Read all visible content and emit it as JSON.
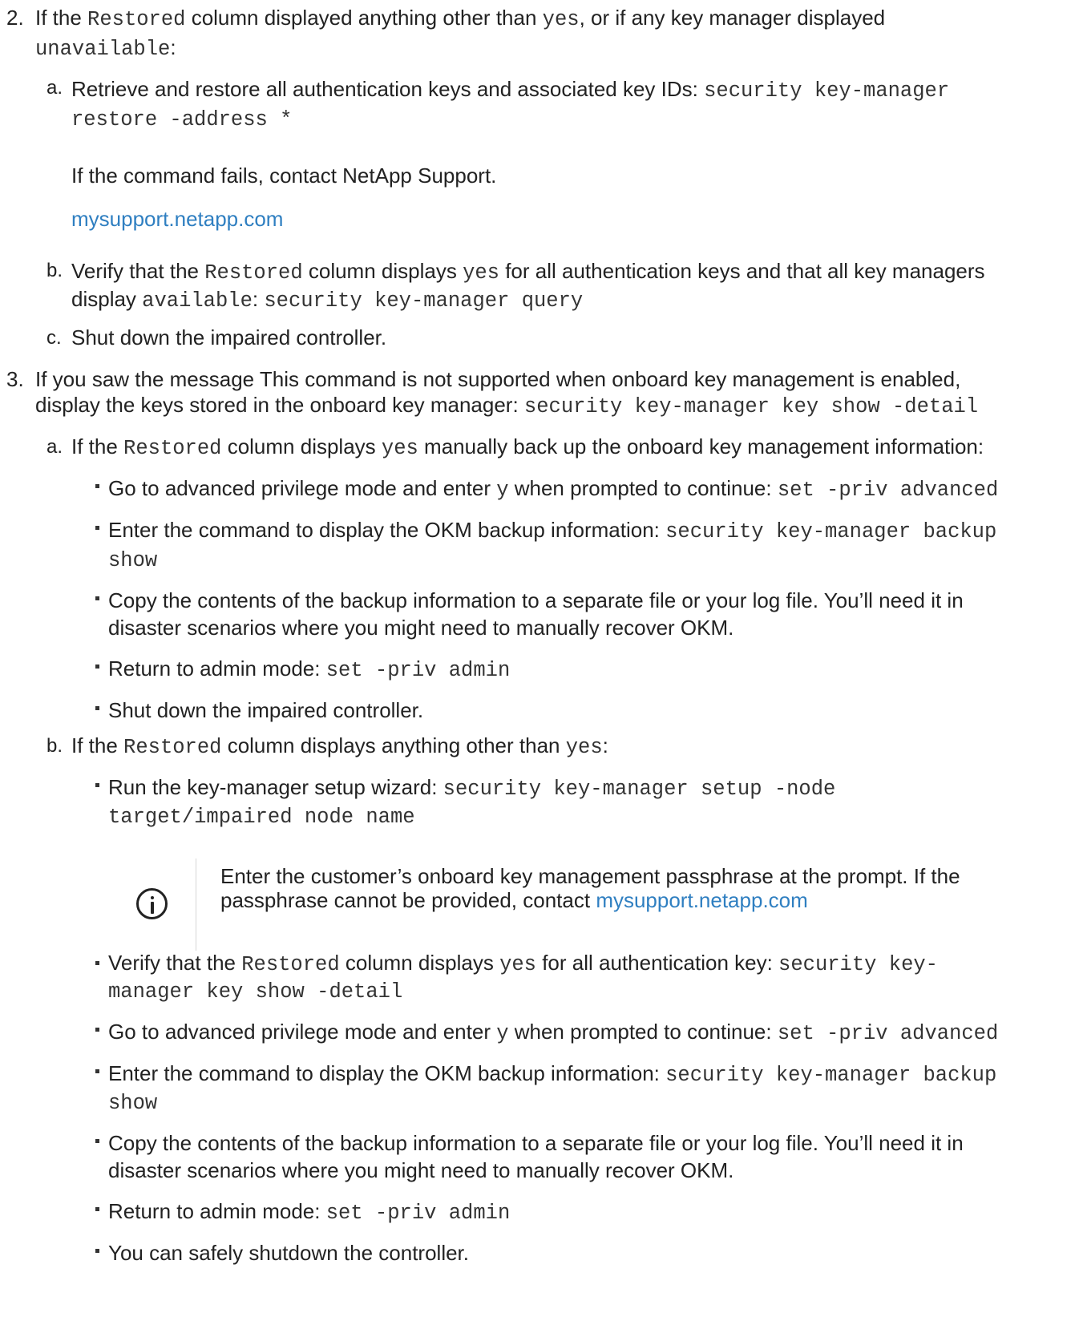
{
  "step2": {
    "number": "2.",
    "line1": {
      "p1": "If the ",
      "c1": "Restored",
      "p2": " column displayed anything other than ",
      "c2": "yes",
      "p3": ", or if any key manager displayed"
    },
    "line2": {
      "c1": "unavailable",
      "p1": ":"
    },
    "a": {
      "label": "a.",
      "line1": {
        "p1": "Retrieve and restore all authentication keys and associated key IDs: ",
        "c1": "security key-manager"
      },
      "line2": {
        "c1": "restore -address *"
      },
      "fail_text": "If the command fails, contact NetApp Support.",
      "support_link": "mysupport.netapp.com"
    },
    "b": {
      "label": "b.",
      "line1": {
        "p1": "Verify that the ",
        "c1": "Restored",
        "p2": " column displays ",
        "c2": "yes",
        "p3": " for all authentication keys and that all key managers"
      },
      "line2": {
        "p1": "display ",
        "c1": "available",
        "p2": ": ",
        "c2": "security key-manager query"
      }
    },
    "c": {
      "label": "c.",
      "text": "Shut down the impaired controller."
    }
  },
  "step3": {
    "number": "3.",
    "line1": "If you saw the message This command is not supported when onboard key management is enabled,",
    "line2": {
      "p1": "display the keys stored in the onboard key manager: ",
      "c1": "security key-manager key show -detail"
    },
    "a": {
      "label": "a.",
      "line1": {
        "p1": "If the ",
        "c1": "Restored",
        "p2": " column displays ",
        "c2": "yes",
        "p3": " manually back up the onboard key management information:"
      },
      "items": {
        "i1": {
          "p1": "Go to advanced privilege mode and enter ",
          "c1": "y",
          "p2": " when prompted to continue: ",
          "c2": "set -priv advanced"
        },
        "i2": {
          "p1": "Enter the command to display the OKM backup information: ",
          "c1": "security key-manager backup",
          "c2": "show"
        },
        "i3": {
          "l1": "Copy the contents of the backup information to a separate file or your log file. You’ll need it in",
          "l2": "disaster scenarios where you might need to manually recover OKM."
        },
        "i4": {
          "p1": "Return to admin mode: ",
          "c1": "set -priv admin"
        },
        "i5": "Shut down the impaired controller."
      }
    },
    "b": {
      "label": "b.",
      "line1": {
        "p1": "If the ",
        "c1": "Restored",
        "p2": " column displays anything other than ",
        "c2": "yes",
        "p3": ":"
      },
      "items": {
        "i1": {
          "p1": "Run the key-manager setup wizard: ",
          "c1": "security key-manager setup -node",
          "c2": "target/impaired node name"
        },
        "note": {
          "l1": "Enter the customer’s onboard key management passphrase at the prompt. If the",
          "l2": "passphrase cannot be provided, contact ",
          "link": "mysupport.netapp.com"
        },
        "i2": {
          "p1": "Verify that the ",
          "c1": "Restored",
          "p2": " column displays ",
          "c2": "yes",
          "p3": " for all authentication key: ",
          "c3": "security key-",
          "c4": "manager key show -detail"
        },
        "i3": {
          "p1": "Go to advanced privilege mode and enter ",
          "c1": "y",
          "p2": " when prompted to continue: ",
          "c2": "set -priv advanced"
        },
        "i4": {
          "p1": "Enter the command to display the OKM backup information: ",
          "c1": "security key-manager backup",
          "c2": "show"
        },
        "i5": {
          "l1": "Copy the contents of the backup information to a separate file or your log file. You’ll need it in",
          "l2": "disaster scenarios where you might need to manually recover OKM."
        },
        "i6": {
          "p1": "Return to admin mode: ",
          "c1": "set -priv admin"
        },
        "i7": "You can safely shutdown the controller."
      }
    }
  }
}
